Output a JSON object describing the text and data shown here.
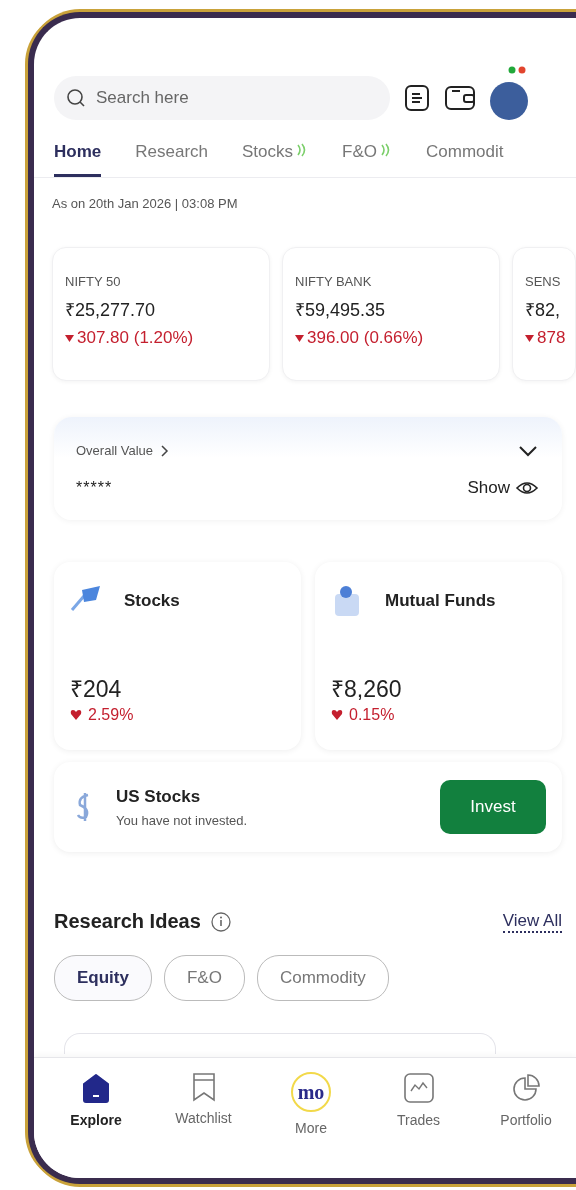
{
  "search": {
    "placeholder": "Search here"
  },
  "tabs": [
    {
      "label": "Home",
      "selected": true,
      "live": false
    },
    {
      "label": "Research",
      "selected": false,
      "live": false
    },
    {
      "label": "Stocks",
      "selected": false,
      "live": true
    },
    {
      "label": "F&O",
      "selected": false,
      "live": true
    },
    {
      "label": "Commodit",
      "selected": false,
      "live": false
    }
  ],
  "as_on": "As on 20th Jan 2026 | 03:08 PM",
  "indices": [
    {
      "name": "NIFTY 50",
      "value": "₹25,277.70",
      "change": "307.80 (1.20%)",
      "falling": true
    },
    {
      "name": "NIFTY BANK",
      "value": "₹59,495.35",
      "change": "396.00 (0.66%)",
      "falling": true
    },
    {
      "name": "SENS",
      "value": "₹82,",
      "change": "878",
      "falling": true
    }
  ],
  "overall_value": {
    "label": "Overall Value",
    "masked_value": "*****",
    "toggle_label": "Show",
    "expanded": false
  },
  "products": [
    {
      "name": "Stocks",
      "value": "₹204",
      "change": "2.59%",
      "falling": true
    },
    {
      "name": "Mutual Funds",
      "value": "₹8,260",
      "change": "0.15%",
      "falling": true
    }
  ],
  "us_stocks": {
    "title": "US Stocks",
    "subtitle": "You have not invested.",
    "button": "Invest"
  },
  "research_ideas": {
    "title": "Research Ideas",
    "view_all": "View All",
    "filters": [
      {
        "label": "Equity",
        "selected": true
      },
      {
        "label": "F&O",
        "selected": false
      },
      {
        "label": "Commodity",
        "selected": false
      }
    ]
  },
  "bottom_nav": [
    {
      "kind": "home",
      "label": "Explore",
      "selected": true
    },
    {
      "kind": "bookmark",
      "label": "Watchlist",
      "selected": false
    },
    {
      "kind": "logo",
      "logo": "mo",
      "label": "More",
      "selected": false
    },
    {
      "kind": "chart",
      "label": "Trades",
      "selected": false
    },
    {
      "kind": "pie",
      "label": "Portfolio",
      "selected": false
    }
  ]
}
